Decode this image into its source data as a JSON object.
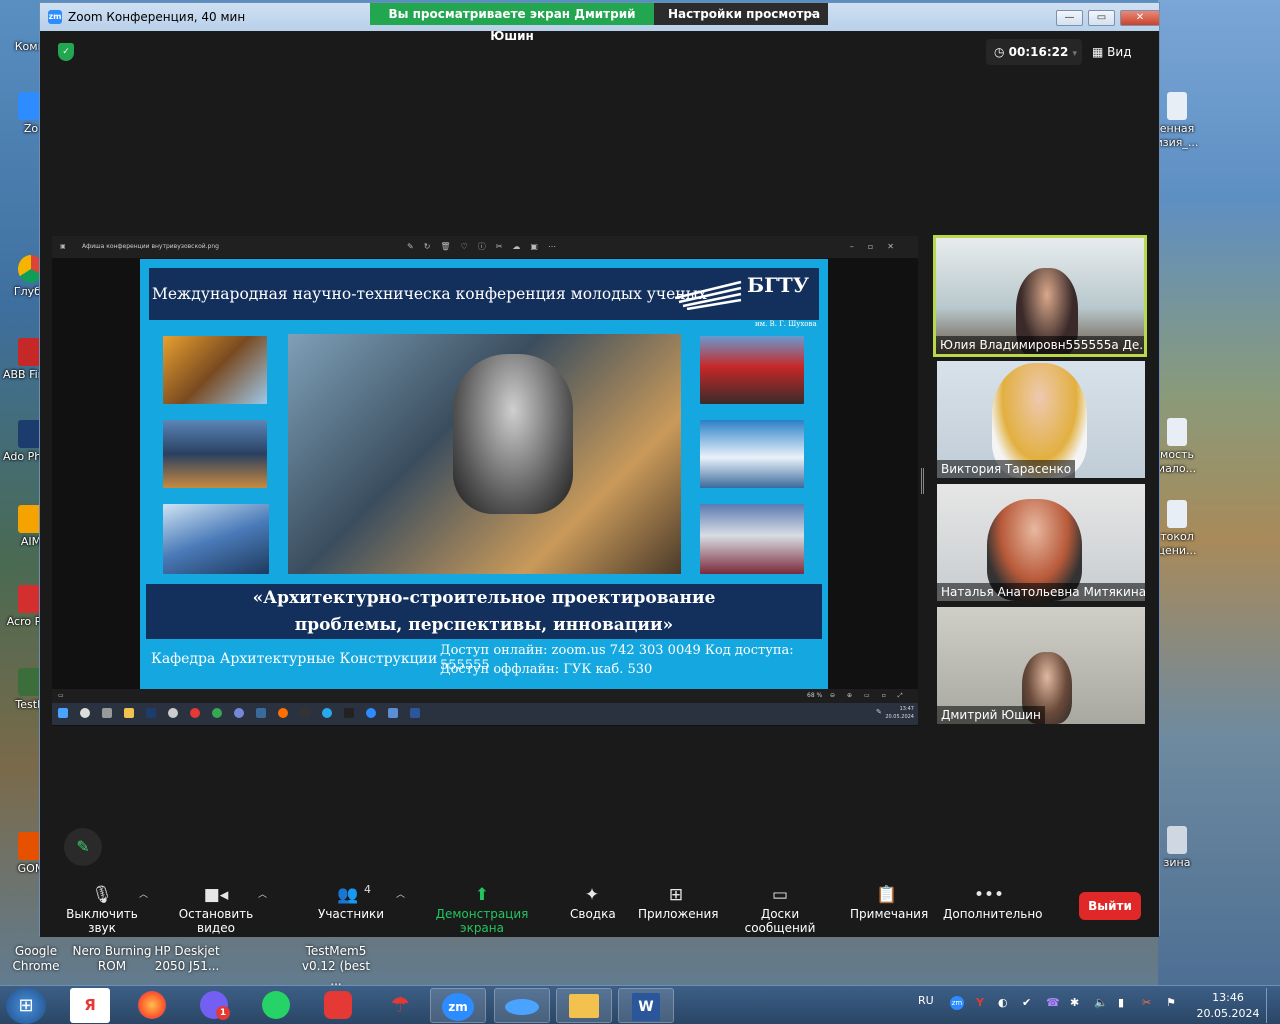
{
  "window": {
    "title": "Zoom Конференция, 40 мин",
    "share_banner": "Вы просматриваете экран Дмитрий Юшин",
    "view_options": "Настройки просмотра",
    "timer": "00:16:22",
    "view_label": "Вид"
  },
  "shared": {
    "file_name": "Афиша конференции внутривузовской.png",
    "zoom_level": "68 %",
    "clock_time": "13:47",
    "clock_date": "20.05.2024",
    "poster": {
      "header": "Международная научно-техническа конференция молодых ученых",
      "logo": "БГТУ",
      "logo_sub": "им. В. Г. Шухова",
      "subtitle_line1": "«Архитектурно-строительное проектирование",
      "subtitle_line2": "проблемы, перспективы, инновации»",
      "department": "Кафедра Архитектурные Конструкции",
      "access_online": "Доступ онлайн: zoom.us  742 303 0049 Код доступа: 555555",
      "access_offline": "Доступ оффлайн: ГУК каб. 530"
    }
  },
  "participants": [
    {
      "name": "Юлия Владимировн555555а Де..."
    },
    {
      "name": "Виктория Тарасенко"
    },
    {
      "name": "Наталья Анатольевна Митякина"
    },
    {
      "name": "Дмитрий Юшин"
    }
  ],
  "toolbar": {
    "mute": "Выключить звук",
    "video": "Остановить видео",
    "participants": "Участники",
    "participants_count": "4",
    "share": "Демонстрация экрана",
    "summary": "Сводка",
    "apps": "Приложения",
    "whiteboards": "Доски сообщений",
    "notes": "Примечания",
    "more": "Дополнительно",
    "leave": "Выйти"
  },
  "desktop": {
    "left_labels": [
      "Компь",
      "Zo",
      "Глуби",
      "ABB FineR",
      "Ado Photo",
      "AIM",
      "Acro Rea",
      "TestM",
      "GOM"
    ],
    "right_labels": [
      "енная изия_...",
      "мость иало...",
      "токол цени...",
      "зина"
    ],
    "bottom_icons": [
      {
        "label": "Google Chrome"
      },
      {
        "label": "Nero Burning ROM"
      },
      {
        "label": "HP Deskjet 2050 J51..."
      },
      {
        "label": "TestMem5 v0.12 (best ..."
      }
    ]
  },
  "taskbar": {
    "apps": [
      "Я",
      "Firefox",
      "Viber",
      "WhatsApp",
      "Tilda",
      "Umbrella",
      "zm",
      "Explorer",
      "Files",
      "Word"
    ],
    "viber_badge": "1",
    "lang": "RU",
    "time": "13:46",
    "date": "20.05.2024"
  }
}
